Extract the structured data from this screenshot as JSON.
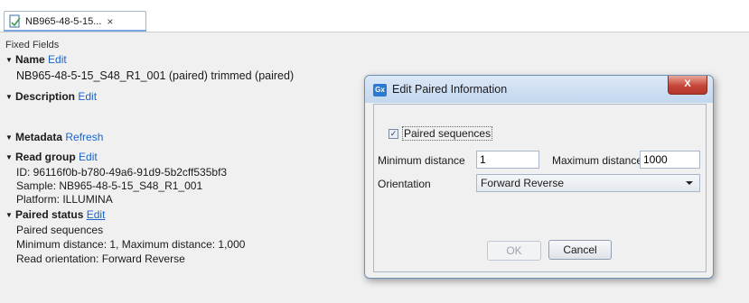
{
  "tab": {
    "title": "NB965-48-5-15...",
    "close": "×"
  },
  "panel": {
    "fixed_fields": "Fixed Fields",
    "name": {
      "label": "Name",
      "link": "Edit",
      "value": "NB965-48-5-15_S48_R1_001 (paired) trimmed (paired)"
    },
    "description": {
      "label": "Description",
      "link": "Edit"
    },
    "metadata": {
      "label": "Metadata",
      "link": "Refresh"
    },
    "read_group": {
      "label": "Read group",
      "link": "Edit",
      "id": "ID: 96116f0b-b780-49a6-91d9-5b2cff535bf3",
      "sample": "Sample: NB965-48-5-15_S48_R1_001",
      "platform": "Platform: ILLUMINA"
    },
    "paired_status": {
      "label": "Paired status",
      "link": "Edit",
      "line1": "Paired sequences",
      "line2": "Minimum distance: 1, Maximum distance: 1,000",
      "line3": "Read orientation: Forward Reverse"
    }
  },
  "dialog": {
    "icon_text": "Gx",
    "title": "Edit Paired Information",
    "close": "X",
    "paired_checkbox": {
      "label": "Paired sequences",
      "checked": true
    },
    "min_label": "Minimum distance",
    "min_value": "1",
    "max_label": "Maximum distance",
    "max_value": "1000",
    "orientation_label": "Orientation",
    "orientation_value": "Forward Reverse",
    "ok": "OK",
    "cancel": "Cancel"
  }
}
